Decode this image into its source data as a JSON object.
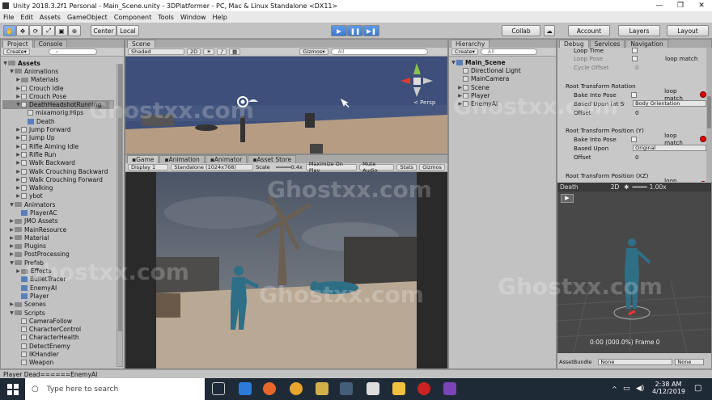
{
  "window": {
    "title": "Unity 2018.3.2f1 Personal - Main_Scene.unity - 3DPlatformer - PC, Mac & Linux Standalone <DX11>"
  },
  "menu": [
    "File",
    "Edit",
    "Assets",
    "GameObject",
    "Component",
    "Tools",
    "Window",
    "Help"
  ],
  "toolbar": {
    "center": "Center",
    "local": "Local",
    "collab": "Collab",
    "account": "Account",
    "layers": "Layers",
    "layout": "Layout"
  },
  "project": {
    "tab1": "Project",
    "tab2": "Console",
    "create": "Create",
    "items": [
      {
        "label": "Assets",
        "depth": 0,
        "kind": "folder",
        "open": true,
        "bold": true
      },
      {
        "label": "Animations",
        "depth": 1,
        "kind": "folder",
        "open": true
      },
      {
        "label": "Materials",
        "depth": 2,
        "kind": "folder"
      },
      {
        "label": "Crouch Idle",
        "depth": 2,
        "kind": "model"
      },
      {
        "label": "Crouch Pose",
        "depth": 2,
        "kind": "model"
      },
      {
        "label": "DeathHeadshotRunning",
        "depth": 2,
        "kind": "model",
        "open": true,
        "sel": true
      },
      {
        "label": "mixamorig:Hips",
        "depth": 3,
        "kind": "go"
      },
      {
        "label": "Death",
        "depth": 3,
        "kind": "anim"
      },
      {
        "label": "Jump Forward",
        "depth": 2,
        "kind": "model"
      },
      {
        "label": "Jump Up",
        "depth": 2,
        "kind": "model"
      },
      {
        "label": "Rifle Aiming Idle",
        "depth": 2,
        "kind": "model"
      },
      {
        "label": "Rifle Run",
        "depth": 2,
        "kind": "model"
      },
      {
        "label": "Walk Backward",
        "depth": 2,
        "kind": "model"
      },
      {
        "label": "Walk Crouching Backward",
        "depth": 2,
        "kind": "model"
      },
      {
        "label": "Walk Crouching Forward",
        "depth": 2,
        "kind": "model"
      },
      {
        "label": "Walking",
        "depth": 2,
        "kind": "model"
      },
      {
        "label": "ybot",
        "depth": 2,
        "kind": "model"
      },
      {
        "label": "Animators",
        "depth": 1,
        "kind": "folder",
        "open": true
      },
      {
        "label": "PlayerAC",
        "depth": 2,
        "kind": "anim"
      },
      {
        "label": "JMO Assets",
        "depth": 1,
        "kind": "folder"
      },
      {
        "label": "MainResource",
        "depth": 1,
        "kind": "folder"
      },
      {
        "label": "Material",
        "depth": 1,
        "kind": "folder"
      },
      {
        "label": "Plugins",
        "depth": 1,
        "kind": "folder"
      },
      {
        "label": "PostProcessing",
        "depth": 1,
        "kind": "folder"
      },
      {
        "label": "Prefab",
        "depth": 1,
        "kind": "folder",
        "open": true
      },
      {
        "label": "Effects",
        "depth": 2,
        "kind": "folder"
      },
      {
        "label": "BulletTracer",
        "depth": 2,
        "kind": "prefab"
      },
      {
        "label": "EnemyAI",
        "depth": 2,
        "kind": "prefab"
      },
      {
        "label": "Player",
        "depth": 2,
        "kind": "prefab"
      },
      {
        "label": "Scenes",
        "depth": 1,
        "kind": "folder"
      },
      {
        "label": "Scripts",
        "depth": 1,
        "kind": "folder",
        "open": true
      },
      {
        "label": "CameraFollow",
        "depth": 2,
        "kind": "script"
      },
      {
        "label": "CharacterControl",
        "depth": 2,
        "kind": "script"
      },
      {
        "label": "CharacterHealth",
        "depth": 2,
        "kind": "script"
      },
      {
        "label": "DetectEnemy",
        "depth": 2,
        "kind": "script"
      },
      {
        "label": "IKHandler",
        "depth": 2,
        "kind": "script"
      },
      {
        "label": "Weapon",
        "depth": 2,
        "kind": "script"
      }
    ]
  },
  "scene": {
    "tab": "Scene",
    "shaded": "Shaded",
    "mode2d": "2D",
    "gizmos": "Gizmos",
    "search": "All",
    "persp": "< Persp"
  },
  "game": {
    "tabs": [
      "Game",
      "Animation",
      "Animator",
      "Asset Store"
    ],
    "display": "Display 1",
    "res": "Standalone (1024x768)",
    "scale_label": "Scale",
    "scale_val": "0.4x",
    "max": "Maximize On Play",
    "mute": "Mute Audio",
    "stats": "Stats",
    "gizmos": "Gizmos"
  },
  "hierarchy": {
    "tab": "Hierarchy",
    "create": "Create",
    "search": "All",
    "scene": "Main_Scene",
    "items": [
      "Directional Light",
      "MainCamera",
      "Scene",
      "Player",
      "EnemyAI"
    ]
  },
  "inspector": {
    "tabs": [
      "Debug",
      "Services",
      "Navigation"
    ],
    "rows": [
      {
        "t": "cut",
        "label": "Loop Time"
      },
      {
        "t": "chk",
        "label": "Loop Pose",
        "right": "loop match",
        "dim": true
      },
      {
        "t": "lbl",
        "label": "Cycle Offset",
        "value": "0",
        "dim": true
      },
      {
        "t": "head",
        "label": "Root Transform Rotation"
      },
      {
        "t": "chk",
        "label": "Bake Into Pose",
        "right": "loop match",
        "dot": true
      },
      {
        "t": "dd",
        "label": "Based Upon (at St",
        "value": "Body Orientation"
      },
      {
        "t": "lbl",
        "label": "Offset",
        "value": "0"
      },
      {
        "t": "head",
        "label": "Root Transform Position (Y)"
      },
      {
        "t": "chk",
        "label": "Bake Into Pose",
        "right": "loop match",
        "dot": true
      },
      {
        "t": "dd",
        "label": "Based Upon",
        "value": "Original"
      },
      {
        "t": "lbl",
        "label": "Offset",
        "value": "0"
      },
      {
        "t": "head",
        "label": "Root Transform Position (XZ)"
      },
      {
        "t": "chk",
        "label": "Bake Into Pose",
        "right": "loop match",
        "dot": true
      }
    ],
    "preview_title": "Death",
    "preview_2d": "2D",
    "preview_speed": "1.00x",
    "preview_time": "0:00 (000.0%) Frame 0",
    "assetbundle": "AssetBundle",
    "ab_none1": "None",
    "ab_none2": "None"
  },
  "status": "Player Dead======EnemyAI",
  "taskbar": {
    "search": "Type here to search",
    "time": "2:38 AM",
    "date": "4/12/2019"
  },
  "watermark": "Ghostxx.com",
  "colors": {
    "sky": "#3d4f7a",
    "ground": "#b59c83",
    "char": "#2f6f86",
    "playblue": "#3a78d0"
  }
}
